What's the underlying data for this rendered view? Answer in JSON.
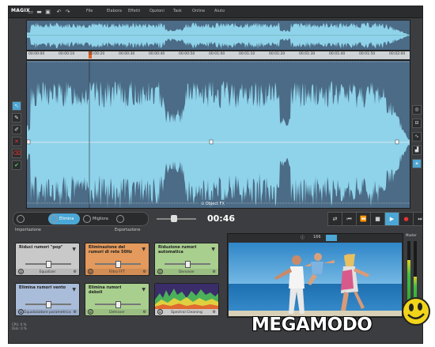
{
  "app": {
    "logo": "MAGIX"
  },
  "menu": {
    "items": [
      "File",
      "Elabora",
      "Effetti",
      "Opzioni",
      "Task",
      "Online",
      "Aiuto"
    ]
  },
  "ruler": {
    "ticks": [
      "00:00:00",
      "00:00:10",
      "00:00:20",
      "00:00:30",
      "00:00:40",
      "00:00:50",
      "00:01:00",
      "00:01:10",
      "00:01:20",
      "00:01:30",
      "00:01:40",
      "00:01:50",
      "00:02:00"
    ]
  },
  "main": {
    "object_label": "⊙ Object FX"
  },
  "transport": {
    "tabs": [
      "Importazione",
      "Elimina",
      "Migliora",
      "Esportazione"
    ],
    "time": "00:46"
  },
  "effects": [
    {
      "title": "Riduci rumori \"pop\"",
      "name": "Equalizer",
      "color": "#c9c9c9"
    },
    {
      "title": "Eliminazione del rumori di rete 50Hz",
      "name": "Filtro FFT",
      "color": "#e39a5c"
    },
    {
      "title": "Riduzione rumori automatica",
      "name": "Denoiser",
      "color": "#a9cf8f"
    },
    {
      "title": "Elimina rumori vento",
      "name": "Equalizzatore parametrico",
      "color": "#a9bcd9"
    },
    {
      "title": "Elimina rumori deboli",
      "name": "Dehisser",
      "color": "#a9cf8f"
    },
    {
      "title": "",
      "name": "Spectral Cleaning",
      "color": "#8c7db8"
    }
  ],
  "video": {
    "toolbar": [
      "ⓘ",
      "166"
    ]
  },
  "meter": {
    "label": "Master",
    "level_left": 0.72,
    "level_right": 0.48
  },
  "status": {
    "line1": "CPU: 0 %",
    "line2": "Disk: 0 %"
  },
  "watermark": "MEGAMODO"
}
